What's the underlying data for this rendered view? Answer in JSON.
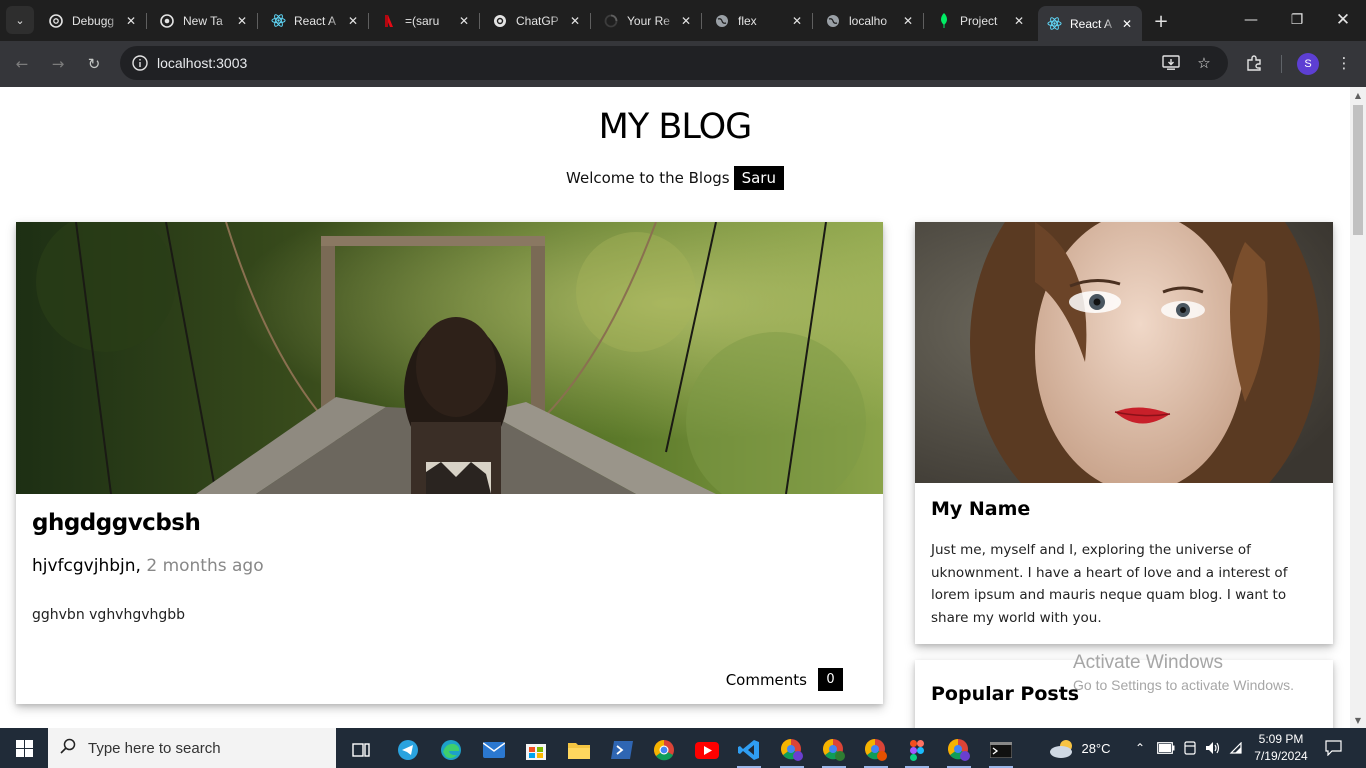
{
  "browser": {
    "tabs": [
      {
        "label": "Debugg",
        "icon": "chatgpt-icon"
      },
      {
        "label": "New Ta",
        "icon": "chrome-icon"
      },
      {
        "label": "React A",
        "icon": "react-icon"
      },
      {
        "label": "=(saru",
        "icon": "app-icon"
      },
      {
        "label": "ChatGP",
        "icon": "chatgpt-icon"
      },
      {
        "label": "Your Re",
        "icon": "loading-icon"
      },
      {
        "label": "flex",
        "icon": "globe-icon"
      },
      {
        "label": "localho",
        "icon": "globe-icon"
      },
      {
        "label": "Project",
        "icon": "mongodb-leaf-icon"
      },
      {
        "label": "React A",
        "icon": "react-icon"
      }
    ],
    "active_tab_index": 9,
    "url": "localhost:3003",
    "profile_initial": "S"
  },
  "page": {
    "blog_title": "MY BLOG",
    "welcome_text": "Welcome to the Blogs",
    "username": "Saru",
    "post": {
      "title": "ghgdggvcbsh",
      "author": "hjvfcgvjhbjn,",
      "time_ago": "2 months ago",
      "body": "gghvbn vghvhgvhgbb",
      "comments_label": "Comments",
      "comments_count": "0"
    },
    "about": {
      "name": "My Name",
      "text": "Just me, myself and I, exploring the universe of uknownment. I have a heart of love and a interest of lorem ipsum and mauris neque quam blog. I want to share my world with you."
    },
    "popular_posts_title": "Popular Posts"
  },
  "watermark": {
    "line1": "Activate Windows",
    "line2": "Go to Settings to activate Windows."
  },
  "taskbar": {
    "search_placeholder": "Type here to search",
    "temperature": "28°C",
    "time": "5:09 PM",
    "date": "7/19/2024"
  },
  "colors": {
    "chrome_dark": "#1f1f1f",
    "toolbar": "#35363a",
    "taskbar": "#202b38",
    "tag_bg": "#000000"
  }
}
